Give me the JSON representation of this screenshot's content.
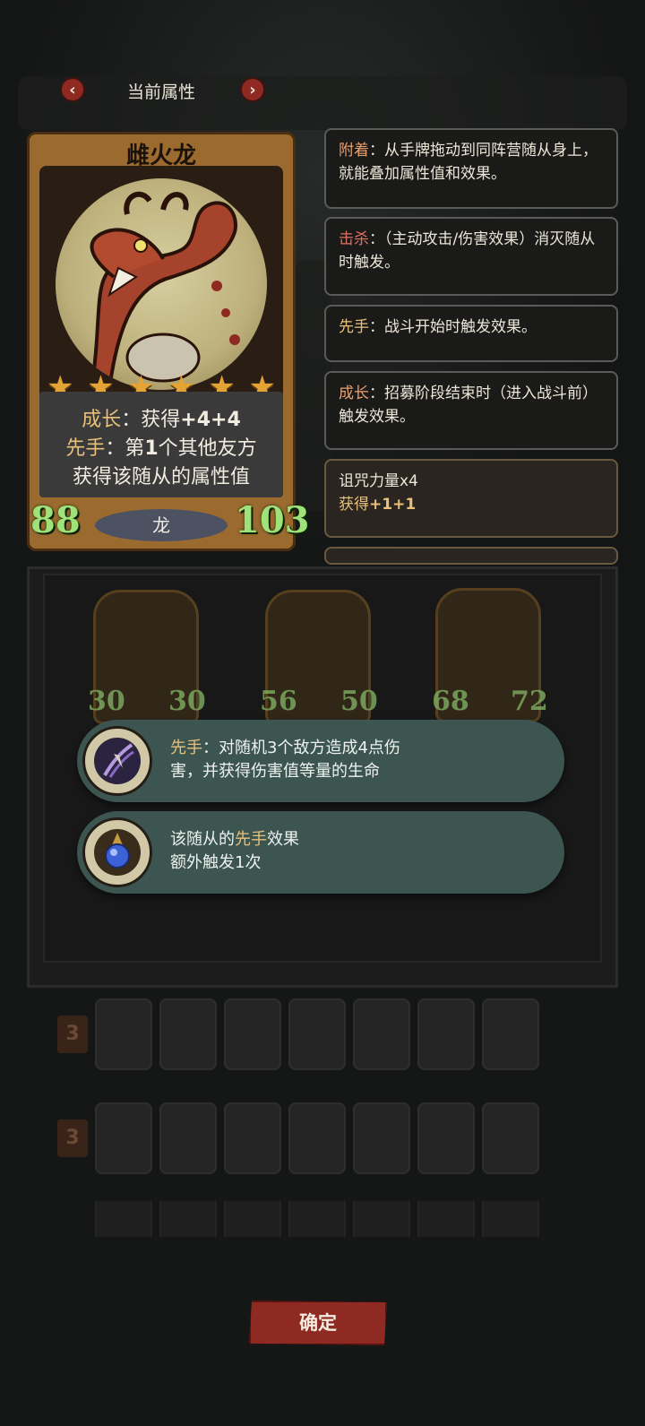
{
  "header": {
    "title": "当前属性",
    "prev_icon": "chevron-left-icon",
    "next_icon": "chevron-right-icon",
    "prev_glyph": "‹",
    "next_glyph": "›"
  },
  "card": {
    "name": "雌火龙",
    "stars": 6,
    "star_glyph": "★",
    "desc": {
      "line1_kw": "成长",
      "line1_sep": "：",
      "line1_text": "获得",
      "line1_bold": "+4+4",
      "line2_kw": "先手",
      "line2_sep": "：",
      "line2_text_a": "第",
      "line2_bold": "1",
      "line2_text_b": "个其他友方",
      "line3": "获得该随从的属性值"
    },
    "attack": "88",
    "health": "103",
    "race": "龙",
    "colors": {
      "accent": "#e8c07a",
      "stat": "#9fe27a",
      "frame": "#9a6a2f"
    }
  },
  "info_panels": [
    {
      "keyword": "附着",
      "sep": "：",
      "text": "从手牌拖动到同阵营随从身上，就能叠加属性值和效果。",
      "keyword_color": "#e8a070"
    },
    {
      "keyword": "击杀",
      "sep": "：",
      "text": "（主动攻击/伤害效果）消灭随从时触发。",
      "keyword_color": "#e07060"
    },
    {
      "keyword": "先手",
      "sep": "：",
      "text": "战斗开始时触发效果。",
      "keyword_color": "#e8c07a"
    },
    {
      "keyword": "成长",
      "sep": "：",
      "text": "招募阶段结束时（进入战斗前）触发效果。",
      "keyword_color": "#e8a070"
    }
  ],
  "curse_panel": {
    "title": "诅咒力量x4",
    "subtitle_text": "获得",
    "subtitle_bold": "+1+1"
  },
  "board_minions": [
    {
      "attack": "30",
      "health": "30"
    },
    {
      "attack": "56",
      "health": "50"
    },
    {
      "attack": "68",
      "health": "72"
    }
  ],
  "popups": [
    {
      "keyword": "先手",
      "line1_rest": "：对随机3个敌方造成4点伤",
      "line2": "害，并获得伤害值等量的生命",
      "icon": "claw-strike-icon"
    },
    {
      "line1_a": "该随从的",
      "keyword": "先手",
      "line1_b": "效果",
      "line2": "额外触发1次",
      "icon": "blue-orb-icon"
    }
  ],
  "bench": {
    "rows": [
      {
        "tier": "3"
      },
      {
        "tier": "3"
      }
    ]
  },
  "confirm_label": "确定"
}
